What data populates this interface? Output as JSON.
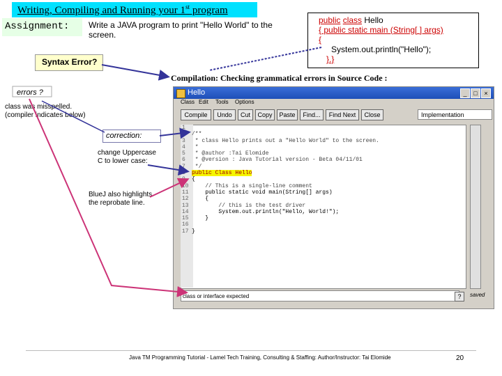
{
  "slide": {
    "title_main": "Writing, Compiling and Running your 1",
    "title_sup": "st",
    "title_end": " program",
    "assignment_label": "Assignment:",
    "task_text": "Write a JAVA program to print \"Hello World\" to the screen.",
    "syntax_error": "Syntax Error?",
    "compilation_heading": "Compilation: Checking grammatical errors in Source Code :",
    "errors_label": "errors ?",
    "misspelled_line1": "class was misspelled.",
    "misspelled_line2": "(compiler indicates below)",
    "correction_label": "correction:",
    "change_line1": "change Uppercase",
    "change_line2": "C to lower case:",
    "bluej_line1": "BlueJ also highlights",
    "bluej_line2": "the reprobate line.",
    "footer": "Java TM Programming Tutorial - Lamel Tech Training, Consulting & Staffing: Author/Instructor: Tai Elomide",
    "page_number": "20"
  },
  "code_box": {
    "line1_kw1": "public",
    "line1_kw2": "class",
    "line1_rest": " Hello",
    "line2": " { public static main (String[ ] args)",
    "line3": " {",
    "line4": "System.out.println(\"Hello\");",
    "line5": "}.}"
  },
  "bluej_window": {
    "title": "Hello",
    "menu": [
      "Class",
      "Edit",
      "Tools",
      "Options"
    ],
    "toolbar": [
      "Compile",
      "Undo",
      "Cut",
      "Copy",
      "Paste",
      "Find...",
      "Find Next",
      "Close"
    ],
    "view_selector": "Implementation",
    "status_text": "class or interface expected",
    "status_saved": "saved",
    "code": [
      {
        "n": "1",
        "t": ""
      },
      {
        "n": "2",
        "t": "/**"
      },
      {
        "n": "3",
        "t": " * class Hello prints out a \"Hello World\" to the screen."
      },
      {
        "n": "4",
        "t": " *"
      },
      {
        "n": "5",
        "t": " * @author :Tai Elomide"
      },
      {
        "n": "6",
        "t": " * @version : Java Tutorial version - Beta 04/11/01"
      },
      {
        "n": "7",
        "t": " */"
      },
      {
        "n": "8",
        "t": "public Class Hello"
      },
      {
        "n": "9",
        "t": "{"
      },
      {
        "n": "10",
        "t": "    // This is a single-line comment"
      },
      {
        "n": "11",
        "t": "    public static void main(String[] args)"
      },
      {
        "n": "12",
        "t": "    {"
      },
      {
        "n": "13",
        "t": "        // this is the test driver"
      },
      {
        "n": "14",
        "t": "        System.out.println(\"Hello, World!\");"
      },
      {
        "n": "15",
        "t": "    }"
      },
      {
        "n": "16",
        "t": ""
      },
      {
        "n": "17",
        "t": "}"
      }
    ]
  },
  "colors": {
    "title_bg": "#00e1ff",
    "keyword_red": "#cc0000",
    "highlight": "#f5f500",
    "arrow_blue": "#333399",
    "arrow_magenta": "#cc3377"
  }
}
